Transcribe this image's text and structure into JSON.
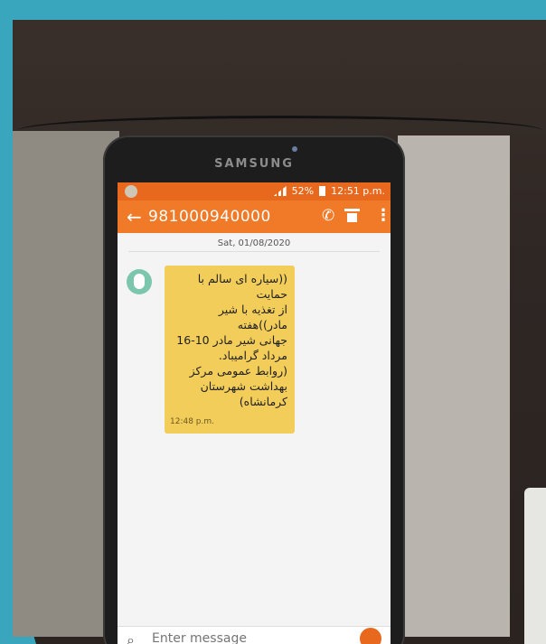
{
  "phone": {
    "brand": "SAMSUNG"
  },
  "status_bar": {
    "battery": "52%",
    "time": "12:51 p.m."
  },
  "app_bar": {
    "title": "981000940000"
  },
  "conversation": {
    "date": "Sat, 01/08/2020",
    "message": {
      "text": "((سیاره ای سالم با حمایت\nاز تغذیه با شیر مادر))هفته\nجهانی شیر مادر 10-16\nمرداد گرامیباد.\n(روابط عمومی مرکز\nبهداشت شهرستان\nکرمانشاه)",
      "time": "12:48 p.m."
    }
  },
  "composer": {
    "placeholder": "Enter message"
  },
  "colors": {
    "accent": "#f07a28",
    "status": "#e8691d",
    "bubble": "#f2cd5a"
  }
}
